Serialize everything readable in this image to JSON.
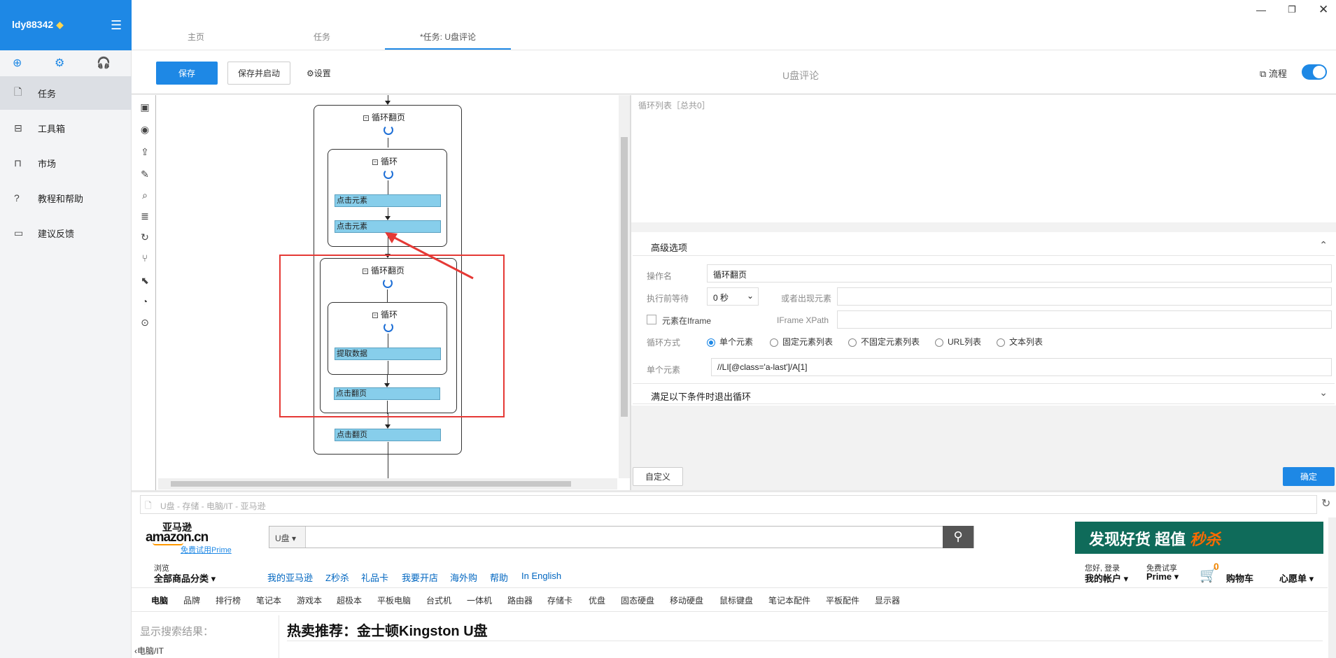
{
  "sidebar": {
    "username": "ldy88342",
    "items": [
      {
        "label": "任务"
      },
      {
        "label": "工具箱"
      },
      {
        "label": "市场"
      },
      {
        "label": "教程和帮助"
      },
      {
        "label": "建议反馈"
      }
    ]
  },
  "tabs": [
    {
      "label": "主页"
    },
    {
      "label": "任务"
    },
    {
      "label": "*任务: U盘评论"
    }
  ],
  "toolbar": {
    "save": "保存",
    "save_start": "保存并启动",
    "settings": "设置",
    "task_title": "U盘评论",
    "flow_label": "流程"
  },
  "flow": {
    "outer_loop": "循环翻页",
    "loop1": "循环",
    "click1": "点击元素",
    "click2": "点击元素",
    "inner_page_loop": "循环翻页",
    "loop2": "循环",
    "extract": "提取数据",
    "click_page_inner": "点击翻页",
    "click_page_outer": "点击翻页"
  },
  "panel": {
    "loop_list_title": "循环列表［总共0］",
    "advanced": "高级选项",
    "op_name_label": "操作名",
    "op_name_value": "循环翻页",
    "wait_label": "执行前等待",
    "wait_value": "0 秒",
    "or_appear_label": "或者出现元素",
    "iframe_label": "元素在Iframe",
    "iframe_xpath_label": "IFrame XPath",
    "loop_mode_label": "循环方式",
    "modes": [
      {
        "label": "单个元素",
        "selected": true
      },
      {
        "label": "固定元素列表",
        "selected": false
      },
      {
        "label": "不固定元素列表",
        "selected": false
      },
      {
        "label": "URL列表",
        "selected": false
      },
      {
        "label": "文本列表",
        "selected": false
      }
    ],
    "single_el_label": "单个元素",
    "single_el_value": "//LI[@class='a-last']/A[1]",
    "exit_cond": "满足以下条件时退出循环",
    "custom_btn": "自定义",
    "ok_btn": "确定"
  },
  "browser": {
    "address": "U盘 - 存储 - 电脑/IT - 亚马逊",
    "logo_cn": "亚马逊",
    "logo_en": "amazon.cn",
    "prime_trial": "免费试用Prime",
    "search_scope": "U盘",
    "banner_text": "发现好货 超值",
    "banner_hot": "秒杀",
    "browse": "浏览",
    "all_categories": "全部商品分类",
    "nav": [
      "我的亚马逊",
      "Z秒杀",
      "礼品卡",
      "我要开店",
      "海外购",
      "帮助",
      "In English"
    ],
    "hello": "您好, 登录",
    "my_account": "我的帐户",
    "free_trial": "免费试享",
    "prime": "Prime",
    "cart_count": "0",
    "cart": "购物车",
    "wishlist": "心愿单",
    "subnav": [
      "电脑",
      "品牌",
      "排行榜",
      "笔记本",
      "游戏本",
      "超极本",
      "平板电脑",
      "台式机",
      "一体机",
      "路由器",
      "存储卡",
      "优盘",
      "固态硬盘",
      "移动硬盘",
      "鼠标键盘",
      "笔记本配件",
      "平板配件",
      "显示器"
    ],
    "results_label": "显示搜索结果：",
    "breadcrumb": "电脑/IT",
    "hot_title": "热卖推荐：金士顿Kingston U盘"
  },
  "colors": {
    "accent": "#1e88e5",
    "highlight": "#e53935",
    "action_node": "#87ceeb"
  }
}
